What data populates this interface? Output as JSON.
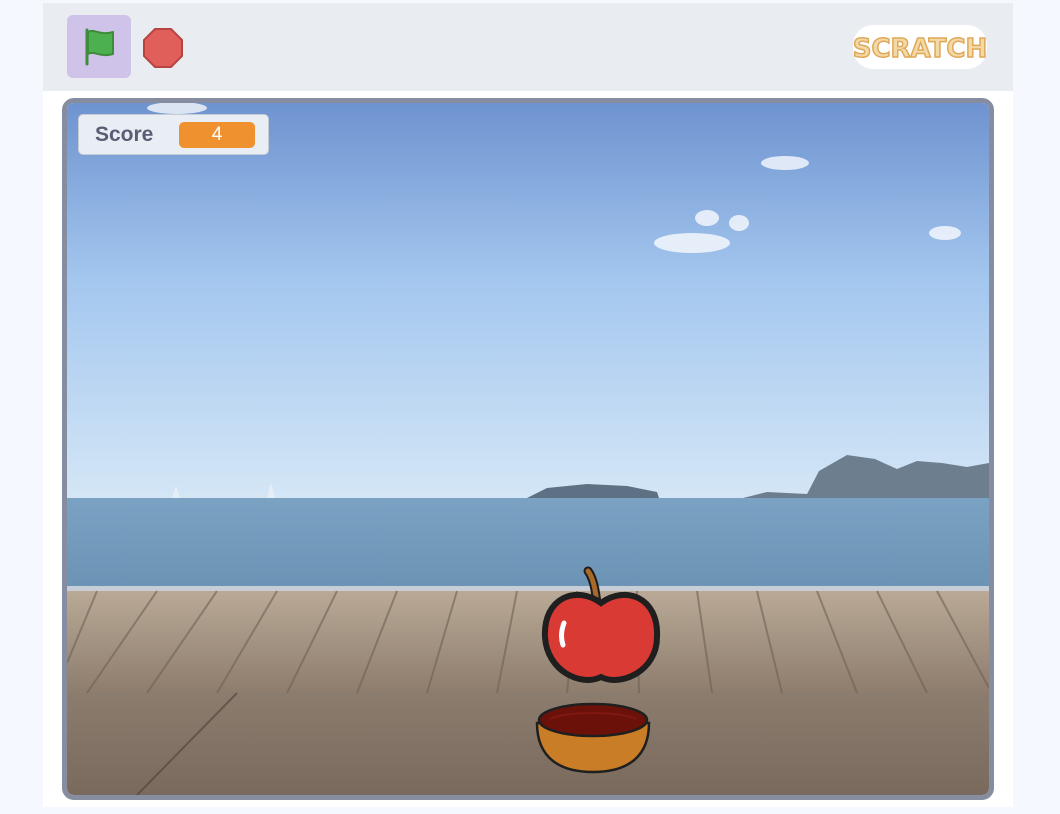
{
  "controls": {
    "green_flag_icon": "green-flag-icon",
    "stop_icon": "stop-sign-icon",
    "logo_text": "SCRATCH"
  },
  "stage": {
    "backdrop": "boardwalk-seaside",
    "monitor": {
      "label": "Score",
      "value": "4"
    },
    "sprites": [
      "apple",
      "bowl"
    ]
  },
  "colors": {
    "flag_button_bg": "#cfc3e9",
    "flag": "#4caf50",
    "stop": "#e05f5b",
    "monitor_value_bg": "#f0912f",
    "logo": "#e8bf7a",
    "stage_border": "#868da0"
  }
}
